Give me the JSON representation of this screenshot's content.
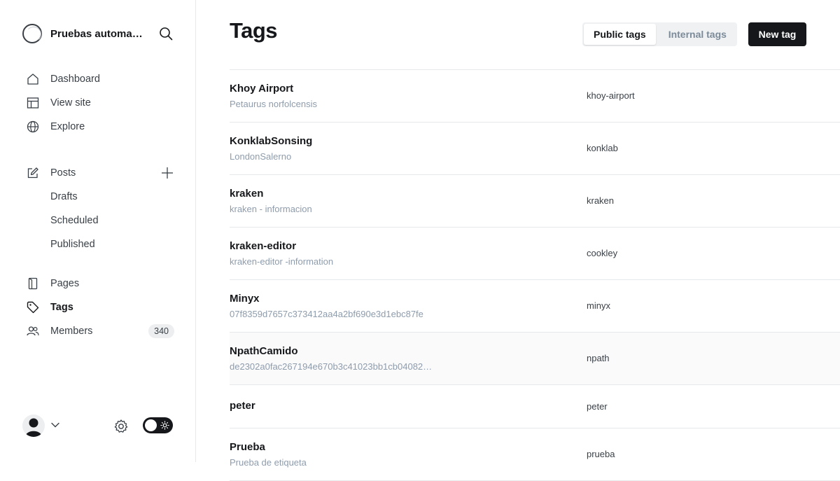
{
  "sidebar": {
    "site_title": "Pruebas automa…",
    "primary_nav": [
      {
        "label": "Dashboard",
        "icon": "home-icon"
      },
      {
        "label": "View site",
        "icon": "layout-icon"
      },
      {
        "label": "Explore",
        "icon": "globe-icon"
      }
    ],
    "posts": {
      "label": "Posts",
      "icon": "edit-icon"
    },
    "posts_sub": [
      {
        "label": "Drafts"
      },
      {
        "label": "Scheduled"
      },
      {
        "label": "Published"
      }
    ],
    "secondary_nav": [
      {
        "label": "Pages",
        "icon": "page-icon"
      },
      {
        "label": "Tags",
        "icon": "tag-icon"
      },
      {
        "label": "Members",
        "icon": "users-icon",
        "count": "340"
      }
    ]
  },
  "main": {
    "title": "Tags",
    "tabs": [
      {
        "label": "Public tags",
        "active": true
      },
      {
        "label": "Internal tags",
        "active": false
      }
    ],
    "new_tag_label": "New tag",
    "tags": [
      {
        "name": "Khoy Airport",
        "description": "Petaurus norfolcensis",
        "slug": "khoy-airport"
      },
      {
        "name": "KonklabSonsing",
        "description": "LondonSalerno",
        "slug": "konklab"
      },
      {
        "name": "kraken",
        "description": "kraken - informacion",
        "slug": "kraken"
      },
      {
        "name": "kraken-editor",
        "description": "kraken-editor -information",
        "slug": "cookley"
      },
      {
        "name": "Minyx",
        "description": "07f8359d7657c373412aa4a2bf690e3d1ebc87fe",
        "slug": "minyx"
      },
      {
        "name": "NpathCamido",
        "description": "de2302a0fac267194e670b3c41023bb1cb04082…",
        "slug": "npath"
      },
      {
        "name": "peter",
        "description": "",
        "slug": "peter"
      },
      {
        "name": "Prueba",
        "description": "Prueba de etiqueta",
        "slug": "prueba"
      }
    ]
  },
  "colors": {
    "accent": "#15171a",
    "muted": "#8e9cac",
    "border": "#e6e9eb"
  }
}
